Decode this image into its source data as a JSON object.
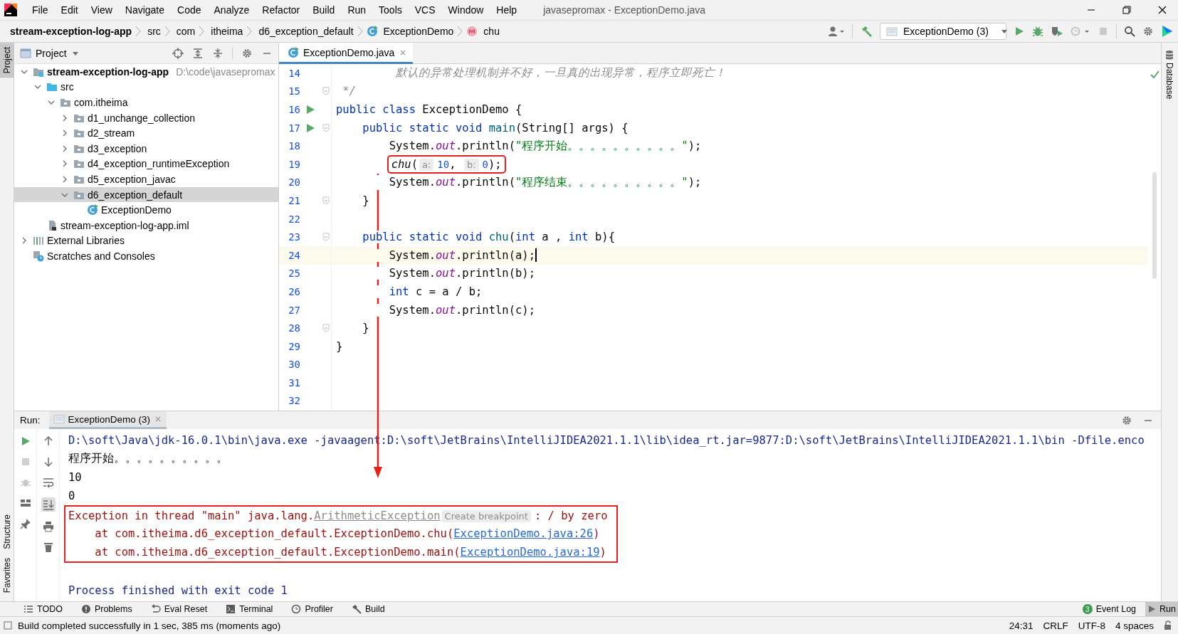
{
  "menu": {
    "items": [
      "File",
      "Edit",
      "View",
      "Navigate",
      "Code",
      "Analyze",
      "Refactor",
      "Build",
      "Run",
      "Tools",
      "VCS",
      "Window",
      "Help"
    ],
    "title": "javasepromax - ExceptionDemo.java"
  },
  "navbar": {
    "crumbs": [
      {
        "label": "stream-exception-log-app",
        "kind": "module"
      },
      {
        "label": "src",
        "kind": "folder"
      },
      {
        "label": "com",
        "kind": "folder"
      },
      {
        "label": "itheima",
        "kind": "folder"
      },
      {
        "label": "d6_exception_default",
        "kind": "folder"
      },
      {
        "label": "ExceptionDemo",
        "kind": "class"
      },
      {
        "label": "chu",
        "kind": "method"
      }
    ],
    "run_config": "ExceptionDemo (3)"
  },
  "left_stripe": [
    {
      "label": "Project",
      "selected": true
    },
    {
      "label": "Structure",
      "selected": false
    },
    {
      "label": "Favorites",
      "selected": false
    }
  ],
  "right_stripe": {
    "label": "Database"
  },
  "project": {
    "title": "Project",
    "tree": [
      {
        "label": "stream-exception-log-app",
        "location": "D:\\code\\javasepromax",
        "kind": "module",
        "expanded": true,
        "selected": false,
        "children": [
          {
            "label": "src",
            "kind": "src",
            "expanded": true,
            "selected": false,
            "children": [
              {
                "label": "com.itheima",
                "kind": "package",
                "expanded": true,
                "selected": false,
                "children": [
                  {
                    "label": "d1_unchange_collection",
                    "kind": "package",
                    "expanded": false,
                    "selected": false
                  },
                  {
                    "label": "d2_stream",
                    "kind": "package",
                    "expanded": false,
                    "selected": false
                  },
                  {
                    "label": "d3_exception",
                    "kind": "package",
                    "expanded": false,
                    "selected": false
                  },
                  {
                    "label": "d4_exception_runtimeException",
                    "kind": "package",
                    "expanded": false,
                    "selected": false
                  },
                  {
                    "label": "d5_exception_javac",
                    "kind": "package",
                    "expanded": false,
                    "selected": false
                  },
                  {
                    "label": "d6_exception_default",
                    "kind": "package",
                    "expanded": true,
                    "selected": true,
                    "children": [
                      {
                        "label": "ExceptionDemo",
                        "kind": "class",
                        "selected": false
                      }
                    ]
                  }
                ]
              }
            ]
          },
          {
            "label": "stream-exception-log-app.iml",
            "kind": "iml",
            "selected": false
          }
        ]
      },
      {
        "label": "External Libraries",
        "kind": "libraries",
        "expanded": false,
        "selected": false
      },
      {
        "label": "Scratches and Consoles",
        "kind": "scratches",
        "selected": false
      }
    ]
  },
  "editor": {
    "tabs": [
      {
        "label": "ExceptionDemo.java",
        "selected": true
      }
    ],
    "lines": [
      {
        "number": "14",
        "run": false,
        "fold": false,
        "current": false,
        "boxed": false,
        "tokens": [
          {
            "t": "         默认的异常处理机制并不好，一旦真的出现异常，程序立即死亡！",
            "kind": "cmt"
          }
        ]
      },
      {
        "number": "15",
        "run": false,
        "fold": true,
        "current": false,
        "boxed": false,
        "tokens": [
          {
            "t": " */",
            "kind": "cmt"
          }
        ]
      },
      {
        "number": "16",
        "run": true,
        "fold": false,
        "current": false,
        "boxed": false,
        "tokens": [
          {
            "t": "public class ",
            "kind": "kw"
          },
          {
            "t": "ExceptionDemo {",
            "kind": "plain"
          }
        ]
      },
      {
        "number": "17",
        "run": true,
        "fold": true,
        "current": false,
        "boxed": false,
        "tokens": [
          {
            "t": "    public static void ",
            "kind": "kw"
          },
          {
            "t": "main",
            "kind": "decl"
          },
          {
            "t": "(String[] args) {",
            "kind": "plain"
          }
        ]
      },
      {
        "number": "18",
        "run": false,
        "fold": false,
        "current": false,
        "boxed": false,
        "tokens": [
          {
            "t": "        System.",
            "kind": "plain"
          },
          {
            "t": "out",
            "kind": "static"
          },
          {
            "t": ".println(",
            "kind": "plain"
          },
          {
            "t": "\"程序开始。。。。。。。。。。\"",
            "kind": "str"
          },
          {
            "t": ");",
            "kind": "plain"
          }
        ]
      },
      {
        "number": "19",
        "run": false,
        "fold": false,
        "current": false,
        "boxed": true,
        "tokens": [
          {
            "t": "        chu",
            "kind": "call"
          },
          {
            "t": "(",
            "kind": "plain"
          },
          {
            "t": "a:",
            "kind": "hint"
          },
          {
            "t": "10",
            "kind": "num"
          },
          {
            "t": ", ",
            "kind": "plain"
          },
          {
            "t": "b:",
            "kind": "hint"
          },
          {
            "t": "0",
            "kind": "num"
          },
          {
            "t": ");",
            "kind": "plain"
          }
        ]
      },
      {
        "number": "20",
        "run": false,
        "fold": false,
        "current": false,
        "boxed": false,
        "tokens": [
          {
            "t": "        System.",
            "kind": "plain"
          },
          {
            "t": "out",
            "kind": "static"
          },
          {
            "t": ".println(",
            "kind": "plain"
          },
          {
            "t": "\"程序结束。。。。。。。。。。\"",
            "kind": "str"
          },
          {
            "t": ");",
            "kind": "plain"
          }
        ]
      },
      {
        "number": "21",
        "run": false,
        "fold": true,
        "current": false,
        "boxed": false,
        "tokens": [
          {
            "t": "    }",
            "kind": "plain"
          }
        ]
      },
      {
        "number": "22",
        "run": false,
        "fold": false,
        "current": false,
        "boxed": false
      },
      {
        "number": "23",
        "run": false,
        "fold": true,
        "current": false,
        "boxed": false,
        "tokens": [
          {
            "t": "    public static void ",
            "kind": "kw"
          },
          {
            "t": "chu",
            "kind": "decl"
          },
          {
            "t": "(",
            "kind": "plain"
          },
          {
            "t": "int",
            "kind": "kw"
          },
          {
            "t": " a , ",
            "kind": "plain"
          },
          {
            "t": "int",
            "kind": "kw"
          },
          {
            "t": " b){",
            "kind": "plain"
          }
        ]
      },
      {
        "number": "24",
        "run": false,
        "fold": false,
        "current": true,
        "boxed": false,
        "tokens": [
          {
            "t": "        System.",
            "kind": "plain"
          },
          {
            "t": "out",
            "kind": "static"
          },
          {
            "t": ".println(a);",
            "kind": "plain"
          }
        ]
      },
      {
        "number": "25",
        "run": false,
        "fold": false,
        "current": false,
        "boxed": false,
        "tokens": [
          {
            "t": "        System.",
            "kind": "plain"
          },
          {
            "t": "out",
            "kind": "static"
          },
          {
            "t": ".println(b);",
            "kind": "plain"
          }
        ]
      },
      {
        "number": "26",
        "run": false,
        "fold": false,
        "current": false,
        "boxed": false,
        "tokens": [
          {
            "t": "        int",
            "kind": "kw"
          },
          {
            "t": " c = a / b;",
            "kind": "plain"
          }
        ]
      },
      {
        "number": "27",
        "run": false,
        "fold": false,
        "current": false,
        "boxed": false,
        "tokens": [
          {
            "t": "        System.",
            "kind": "plain"
          },
          {
            "t": "out",
            "kind": "static"
          },
          {
            "t": ".println(c);",
            "kind": "plain"
          }
        ]
      },
      {
        "number": "28",
        "run": false,
        "fold": true,
        "current": false,
        "boxed": false,
        "tokens": [
          {
            "t": "    }",
            "kind": "plain"
          }
        ]
      },
      {
        "number": "29",
        "run": false,
        "fold": false,
        "current": false,
        "boxed": false,
        "tokens": [
          {
            "t": "}",
            "kind": "plain"
          }
        ]
      },
      {
        "number": "30",
        "run": false,
        "fold": false,
        "current": false,
        "boxed": false
      },
      {
        "number": "31",
        "run": false,
        "fold": false,
        "current": false,
        "boxed": false
      },
      {
        "number": "32",
        "run": false,
        "fold": false,
        "current": false,
        "boxed": false
      }
    ]
  },
  "run": {
    "label": "Run:",
    "tabs": [
      {
        "label": "ExceptionDemo (3)",
        "selected": true
      }
    ],
    "console": [
      {
        "boxed": false,
        "tokens": [
          {
            "t": "D:\\soft\\Java\\jdk-16.0.1\\bin\\java.exe -javaagent:D:\\soft\\JetBrains\\IntelliJIDEA2021.1.1\\lib\\idea_rt.jar=9877:D:\\soft\\JetBrains\\IntelliJIDEA2021.1.1\\bin -Dfile.enco",
            "kind": "sys"
          }
        ]
      },
      {
        "boxed": false,
        "tokens": [
          {
            "t": "程序开始。。。。。。。。。。",
            "kind": "out"
          }
        ]
      },
      {
        "boxed": false,
        "tokens": [
          {
            "t": "10",
            "kind": "out"
          }
        ]
      },
      {
        "boxed": false,
        "tokens": [
          {
            "t": "0",
            "kind": "out"
          }
        ]
      },
      {
        "boxed": true,
        "tokens": [
          {
            "t": "Exception in thread \"main\" java.lang.",
            "kind": "err"
          },
          {
            "t": "ArithmeticException",
            "kind": "errlink"
          },
          {
            "t": "Create breakpoint",
            "kind": "hint"
          },
          {
            "t": ": / by zero",
            "kind": "err"
          }
        ]
      },
      {
        "boxed": true,
        "tokens": [
          {
            "t": "    at com.itheima.d6_exception_default.ExceptionDemo.chu(",
            "kind": "err"
          },
          {
            "t": "ExceptionDemo.java:26",
            "kind": "link"
          },
          {
            "t": ")",
            "kind": "err"
          }
        ]
      },
      {
        "boxed": true,
        "tokens": [
          {
            "t": "    at com.itheima.d6_exception_default.ExceptionDemo.main(",
            "kind": "err"
          },
          {
            "t": "ExceptionDemo.java:19",
            "kind": "link"
          },
          {
            "t": ")",
            "kind": "err"
          }
        ]
      },
      {
        "boxed": false
      },
      {
        "boxed": false,
        "tokens": [
          {
            "t": "Process finished with exit code 1",
            "kind": "sys"
          }
        ]
      }
    ]
  },
  "tool_tabs": {
    "left": [
      {
        "label": "TODO",
        "kind": "list"
      },
      {
        "label": "Problems",
        "kind": "problems"
      },
      {
        "label": "Eval Reset",
        "kind": "reset"
      },
      {
        "label": "Terminal",
        "kind": "terminal"
      },
      {
        "label": "Profiler",
        "kind": "profiler"
      },
      {
        "label": "Build",
        "kind": "build"
      }
    ],
    "right": [
      {
        "label": "Event Log",
        "badge": "3",
        "selected": false
      },
      {
        "label": "Run",
        "selected": true
      }
    ]
  },
  "status": {
    "message": "Build completed successfully in 1 sec, 385 ms (moments ago)",
    "items": [
      "24:31",
      "CRLF",
      "UTF-8",
      "4 spaces"
    ]
  }
}
